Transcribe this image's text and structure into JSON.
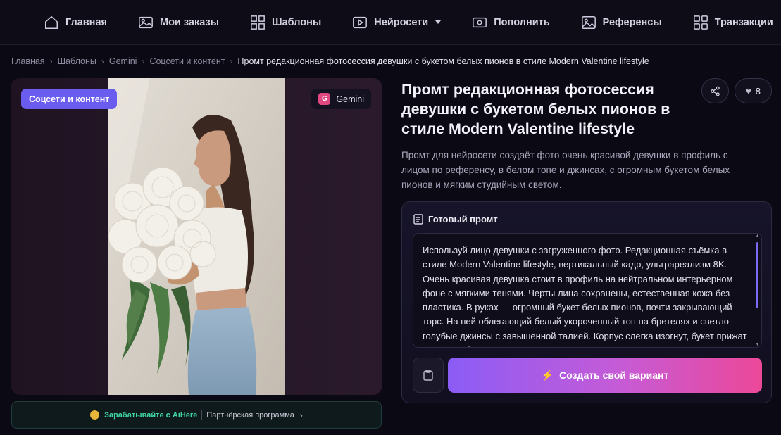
{
  "nav": {
    "items": [
      {
        "label": "Главная",
        "icon": "home-icon"
      },
      {
        "label": "Мои заказы",
        "icon": "image-icon"
      },
      {
        "label": "Шаблоны",
        "icon": "grid-icon"
      },
      {
        "label": "Нейросети",
        "icon": "play-icon",
        "has_dropdown": true
      },
      {
        "label": "Пополнить",
        "icon": "wallet-icon"
      },
      {
        "label": "Референсы",
        "icon": "picture-icon"
      },
      {
        "label": "Транзакции",
        "icon": "apps-icon"
      }
    ]
  },
  "breadcrumb": {
    "items": [
      "Главная",
      "Шаблоны",
      "Gemini",
      "Соцсети и контент"
    ],
    "current": "Промт редакционная фотосессия девушки с букетом белых пионов в стиле Modern Valentine lifestyle",
    "separator": "›"
  },
  "card": {
    "category": "Соцсети и контент",
    "model_icon": "G",
    "model": "Gemini"
  },
  "partner": {
    "earn": "Зарабатывайте с AiHere",
    "program": "Партнёрская программа",
    "chevron": "›"
  },
  "page": {
    "title": "Промт редакционная фотосессия девушки с букетом белых пионов в стиле Modern Valentine lifestyle",
    "likes": "8",
    "description": "Промт для нейросети создаёт фото очень красивой девушки в профиль с лицом по референсу, в белом топе и джинсах, с огромным букетом белых пионов и мягким студийным светом."
  },
  "prompt": {
    "heading": "Готовый промт",
    "text": "Используй лицо девушки с загруженного фото. Редакционная съёмка в стиле Modern Valentine lifestyle, вертикальный кадр, ультрареализм 8K. Очень красивая девушка  стоит в профиль на нейтральном интерьерном фоне с мягкими тенями. Черты лица сохранены, естественная кожа без пластика. В руках — огромный букет белых пионов, почти закрывающий торс. На ней облегающий белый укороченный топ на бретелях и светло-голубые джинсы с завышенной талией. Корпус слегка изогнут, букет прижат к груди, губы сложены так, словно целуют цветы. Минимум",
    "create_label": "Создать свой вариант"
  },
  "colors": {
    "accent": "#6b5cf0",
    "gradient_start": "#8b5cf6",
    "gradient_end": "#ec4899",
    "partner_green": "#3fd6a4"
  }
}
